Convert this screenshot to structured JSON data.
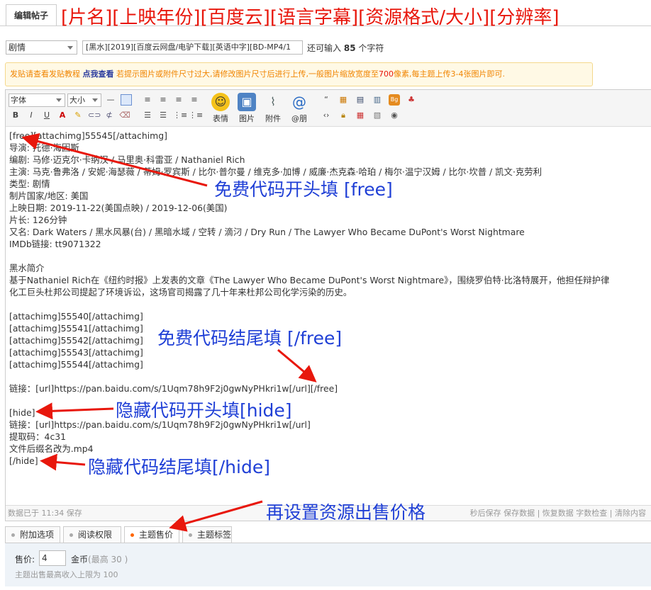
{
  "header": {
    "tab_label": "编辑帖子",
    "title_note": "[片名][上映年份][百度云][语言字幕][资源格式/大小][分辨率]"
  },
  "form": {
    "type_value": "剧情",
    "subject_value": "[黑水][2019][百度云网盘/电驴下载][英语中字][BD-MP4/1",
    "remain_prefix": "还可输入",
    "remain_count": "85",
    "remain_suffix": "个字符"
  },
  "notice": {
    "part1": "发贴请查看发贴教程",
    "link": "点我查看",
    "part2": "若提示图片或附件尺寸过大,请修改图片尺寸后进行上传,一般图片缩放宽度至",
    "num": "700",
    "part3": "像素,每主题上传3-4张图片即可."
  },
  "toolbar": {
    "font_label": "字体",
    "size_label": "大小",
    "emoji_label": "表情",
    "image_label": "图片",
    "attach_label": "附件",
    "at_label": "@朋"
  },
  "content": {
    "lines": [
      "[free][attachimg]55545[/attachimg]",
      "导演: 托德·海因斯",
      "编剧: 马修·迈克尔·卡纳汉 / 马里奥·科雷亚 / Nathaniel Rich",
      "主演: 马克·鲁弗洛 / 安妮·海瑟薇 / 蒂姆·罗宾斯 / 比尔·普尔曼 / 维克多·加博 / 威廉·杰克森·哈珀 / 梅尔·温宁汉姆 / 比尔·坎普 / 凯文·克劳利",
      "类型: 剧情",
      "制片国家/地区: 美国",
      "上映日期: 2019-11-22(美国点映) / 2019-12-06(美国)",
      "片长: 126分钟",
      "又名: Dark Waters / 黑水风暴(台) / 黑暗水域 / 空转 / 滴汈 / Dry Run / The Lawyer Who Became DuPont's Worst Nightmare",
      "IMDb链接: tt9071322",
      "",
      "黑水简介",
      "基于Nathaniel Rich在《纽约时报》上发表的文章《The Lawyer Who Became DuPont's Worst Nightmare》，围绕罗伯特·比洛特展开，他担任辩护律",
      "化工巨头杜邦公司提起了环境诉讼，这场官司揭露了几十年来杜邦公司化学污染的历史。",
      "",
      "[attachimg]55540[/attachimg]",
      "[attachimg]55541[/attachimg]",
      "[attachimg]55542[/attachimg]",
      "[attachimg]55543[/attachimg]",
      "[attachimg]55544[/attachimg]",
      "",
      "链接：[url]https://pan.baidu.com/s/1Uqm78h9F2j0gwNyPHkri1w[/url][/free]",
      "",
      "[hide]",
      "链接：[url]https://pan.baidu.com/s/1Uqm78h9F2j0gwNyPHkri1w[/url]",
      "提取码：4c31",
      "文件后缀名改为.mp4",
      "[/hide]"
    ]
  },
  "status": {
    "saved": "数据已于 11:34 保存",
    "right": "秒后保存 保存数据 | 恢复数据  字数检查 | 清除内容"
  },
  "tabs": [
    "附加选项",
    "阅读权限",
    "主题售价",
    "主题标签"
  ],
  "price": {
    "label": "售价:",
    "value": "4",
    "unit": "金币",
    "max": "(最高 30 )",
    "hint": "主题出售最高收入上限为 100"
  },
  "annotations": {
    "free_start": "免费代码开头填 [free]",
    "free_end": "免费代码结尾填 [/free]",
    "hide_start": "隐藏代码开头填[hide]",
    "hide_end": "隐藏代码结尾填[/hide]",
    "price": "再设置资源出售价格"
  },
  "colors": {
    "annotation_blue": "#1f3fd6",
    "annotation_red": "#e8170c",
    "notice_orange": "#f08400"
  }
}
